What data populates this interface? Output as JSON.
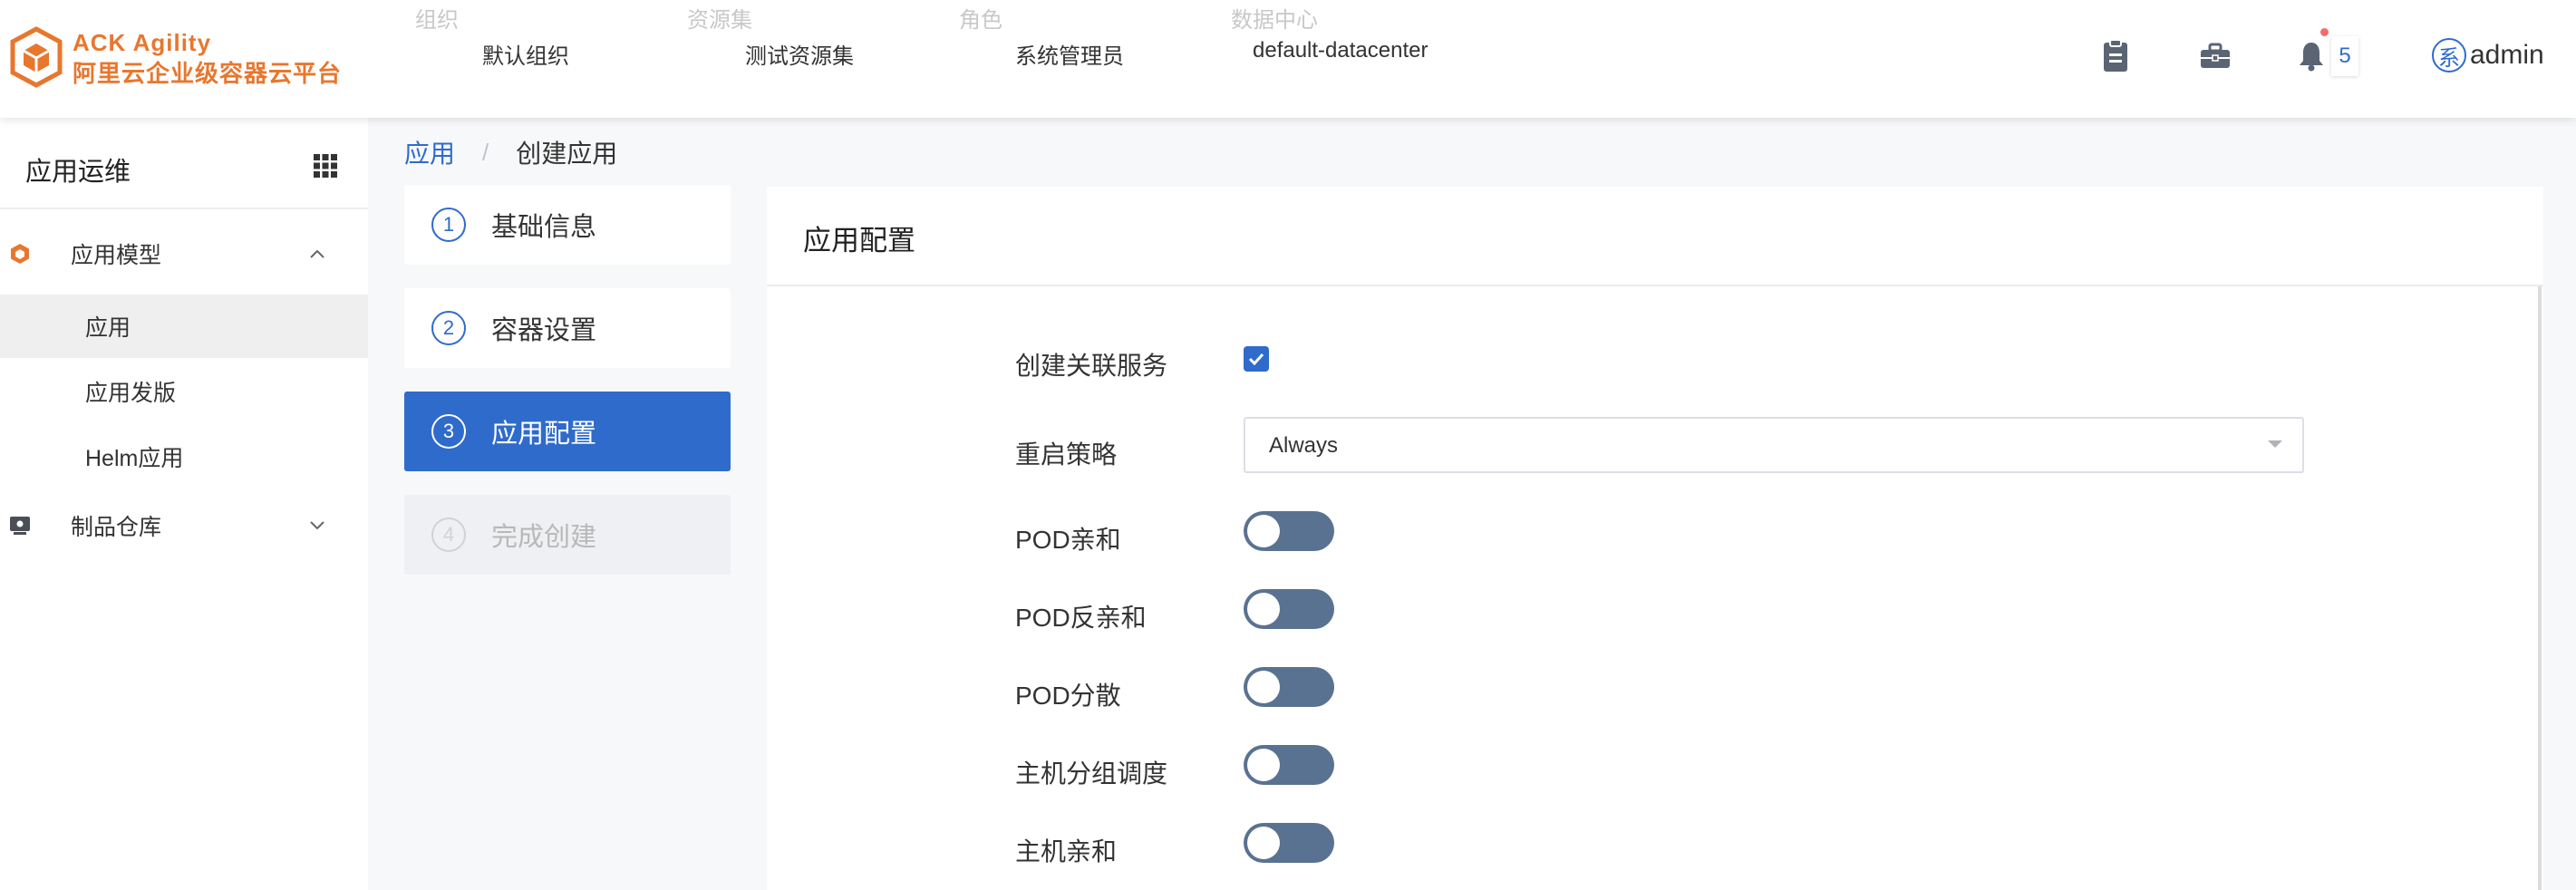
{
  "header": {
    "brand_line1": "ACK  Agility",
    "brand_line2": "阿里云企业级容器云平台",
    "selectors": [
      {
        "label": "组织",
        "value": "默认组织"
      },
      {
        "label": "资源集",
        "value": "测试资源集"
      },
      {
        "label": "角色",
        "value": "系统管理员"
      },
      {
        "label": "数据中心",
        "value": "default-datacenter"
      }
    ],
    "icons": [
      "document-icon",
      "toolbox-icon",
      "bell-icon"
    ],
    "notification_count": "5",
    "user_avatar_char": "系",
    "username": "admin",
    "brand_color": "#e8772e"
  },
  "sidebar": {
    "title": "应用运维",
    "groups": [
      {
        "label": "应用模型",
        "icon": "hexagon-icon",
        "expanded": true
      },
      {
        "label": "制品仓库",
        "icon": "repository-icon",
        "expanded": false
      }
    ],
    "items": [
      {
        "label": "应用",
        "active": true
      },
      {
        "label": "应用发版"
      },
      {
        "label": "Helm应用"
      }
    ]
  },
  "breadcrumb": {
    "link": "应用",
    "separator": "/",
    "current": "创建应用"
  },
  "steps": [
    {
      "num": "1",
      "label": "基础信息",
      "state": "done"
    },
    {
      "num": "2",
      "label": "容器设置",
      "state": "done"
    },
    {
      "num": "3",
      "label": "应用配置",
      "state": "active"
    },
    {
      "num": "4",
      "label": "完成创建",
      "state": "disabled"
    }
  ],
  "panel": {
    "title": "应用配置",
    "fields": {
      "create_service": {
        "label": "创建关联服务",
        "checked": true
      },
      "restart_policy": {
        "label": "重启策略",
        "value": "Always"
      },
      "pod_affinity": {
        "label": "POD亲和",
        "on": false
      },
      "pod_anti_affinity": {
        "label": "POD反亲和",
        "on": false
      },
      "pod_spread": {
        "label": "POD分散",
        "on": false
      },
      "host_group": {
        "label": "主机分组调度",
        "on": false
      },
      "host_affinity": {
        "label": "主机亲和",
        "on": false
      }
    }
  },
  "colors": {
    "primary": "#2f6bcb",
    "toggle_off": "#5a7291"
  }
}
